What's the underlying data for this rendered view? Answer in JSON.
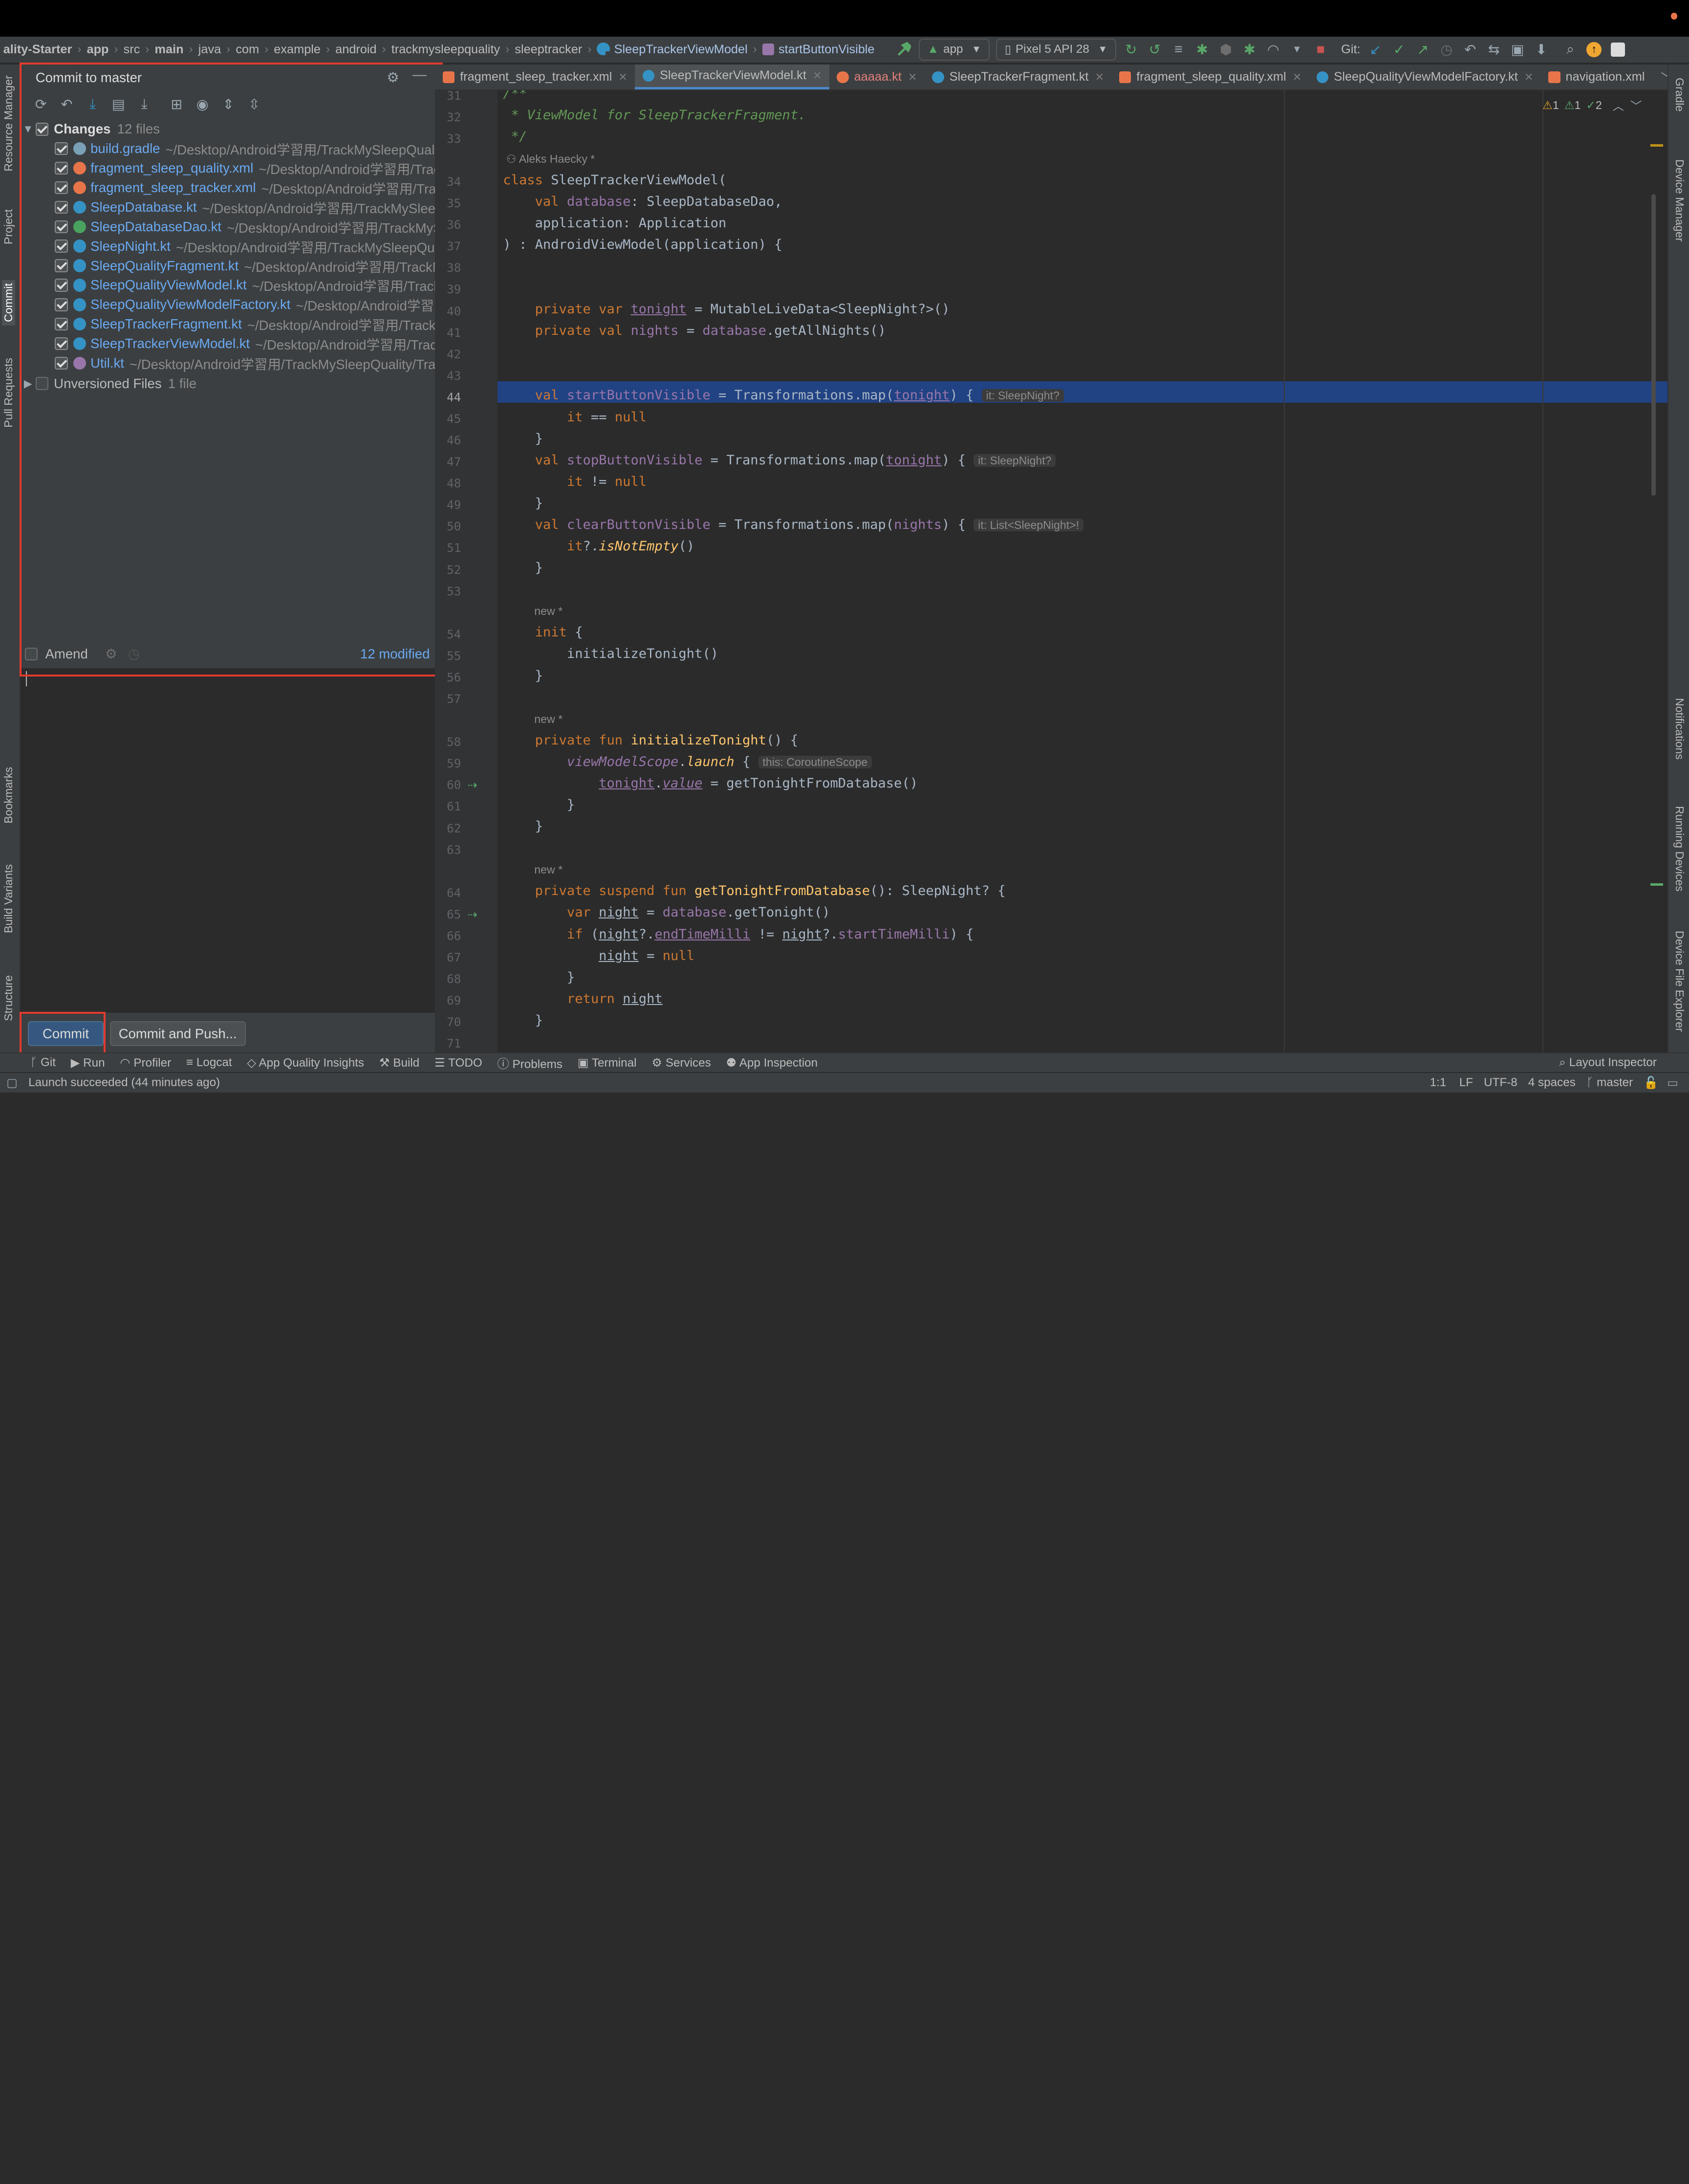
{
  "navbar": {
    "crumbs": [
      "ality-Starter",
      "app",
      "src",
      "main",
      "java",
      "com",
      "example",
      "android",
      "trackmysleepquality",
      "sleeptracker"
    ],
    "class_crumb": "SleepTrackerViewModel",
    "prop_crumb": "startButtonVisible",
    "run_config": "app",
    "device": "Pixel 5 API 28",
    "git_label": "Git:"
  },
  "left_strip": {
    "tabs": [
      "Resource Manager",
      "Project",
      "Commit",
      "Pull Requests",
      "Bookmarks",
      "Build Variants",
      "Structure"
    ]
  },
  "right_strip": {
    "tabs": [
      "Gradle",
      "Device Manager",
      "Notifications",
      "Running Devices",
      "Device File Explorer"
    ]
  },
  "commit_panel": {
    "title": "Commit to master",
    "changes_label": "Changes",
    "changes_count": "12 files",
    "files": [
      {
        "name": "build.gradle",
        "path": "~/Desktop/Android学習用/TrackMySleepQuali",
        "color": "#7aa0b8"
      },
      {
        "name": "fragment_sleep_quality.xml",
        "path": "~/Desktop/Android学習用/Trac",
        "color": "#e8754a"
      },
      {
        "name": "fragment_sleep_tracker.xml",
        "path": "~/Desktop/Android学習用/Tra",
        "color": "#e8754a"
      },
      {
        "name": "SleepDatabase.kt",
        "path": "~/Desktop/Android学習用/TrackMySleep",
        "color": "#3592c4"
      },
      {
        "name": "SleepDatabaseDao.kt",
        "path": "~/Desktop/Android学習用/TrackMyS",
        "color": "#49a35e"
      },
      {
        "name": "SleepNight.kt",
        "path": "~/Desktop/Android学習用/TrackMySleepQu",
        "color": "#3592c4"
      },
      {
        "name": "SleepQualityFragment.kt",
        "path": "~/Desktop/Android学習用/TrackM",
        "color": "#3592c4"
      },
      {
        "name": "SleepQualityViewModel.kt",
        "path": "~/Desktop/Android学習用/Track",
        "color": "#3592c4"
      },
      {
        "name": "SleepQualityViewModelFactory.kt",
        "path": "~/Desktop/Android学習",
        "color": "#3592c4"
      },
      {
        "name": "SleepTrackerFragment.kt",
        "path": "~/Desktop/Android学習用/TrackM",
        "color": "#3592c4"
      },
      {
        "name": "SleepTrackerViewModel.kt",
        "path": "~/Desktop/Android学習用/Track",
        "color": "#3592c4"
      },
      {
        "name": "Util.kt",
        "path": "~/Desktop/Android学習用/TrackMySleepQuality/Trac",
        "color": "#9876aa"
      }
    ],
    "unversioned_label": "Unversioned Files",
    "unversioned_count": "1 file",
    "amend_label": "Amend",
    "modified_label": "12 modified",
    "commit_button": "Commit",
    "commit_push_button": "Commit and Push..."
  },
  "tabs": [
    {
      "label": "fragment_sleep_tracker.xml",
      "color": "#e8754a",
      "selected": false
    },
    {
      "label": "SleepTrackerViewModel.kt",
      "color": "#3592c4",
      "selected": true
    },
    {
      "label": "aaaaa.kt",
      "color": "#e8754a",
      "selected": false
    },
    {
      "label": "SleepTrackerFragment.kt",
      "color": "#3592c4",
      "selected": false
    },
    {
      "label": "fragment_sleep_quality.xml",
      "color": "#e8754a",
      "selected": false
    },
    {
      "label": "SleepQualityViewModelFactory.kt",
      "color": "#3592c4",
      "selected": false
    },
    {
      "label": "navigation.xml",
      "color": "#e8754a",
      "selected": false
    }
  ],
  "inspections": {
    "warn": "1",
    "weak": "1",
    "ok": "2"
  },
  "editor": {
    "author_annotation": "Aleks Haecky *",
    "new_annotation": "new *",
    "hints": {
      "start": "it: SleepNight?",
      "stop": "it: SleepNight?",
      "clear": "it: List<SleepNight>!",
      "scope": "this: CoroutineScope"
    }
  },
  "bottom_tools": [
    "Git",
    "Run",
    "Profiler",
    "Logcat",
    "App Quality Insights",
    "Build",
    "TODO",
    "Problems",
    "Terminal",
    "Services",
    "App Inspection"
  ],
  "layout_inspector": "Layout Inspector",
  "status": {
    "message": "Launch succeeded (44 minutes ago)",
    "position": "1:1",
    "line_sep": "LF",
    "encoding": "UTF-8",
    "indent": "4 spaces",
    "branch": "master"
  }
}
